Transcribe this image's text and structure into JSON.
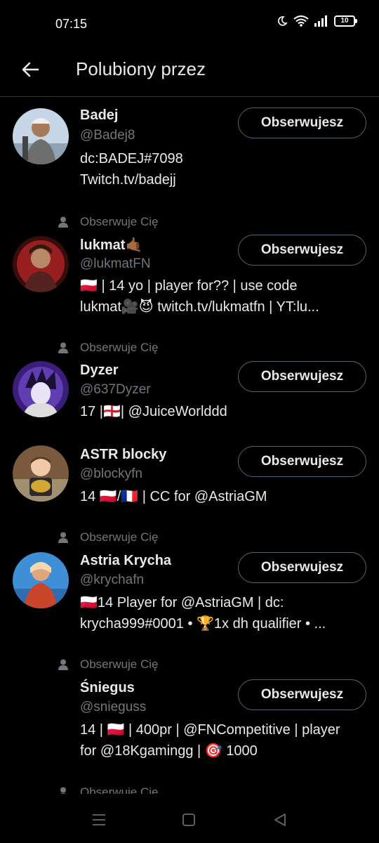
{
  "status_bar": {
    "time": "07:15",
    "battery_level": "10",
    "icons": [
      "moon-icon",
      "wifi-icon",
      "signal-icon",
      "battery-icon"
    ]
  },
  "header": {
    "title": "Polubiony przez",
    "back_icon": "arrow-left-icon"
  },
  "follows_you_label": "Obserwuje Cię",
  "follow_button_label": "Obserwujesz",
  "users": [
    {
      "name": "Badej",
      "handle": "@Badej8",
      "bio": [
        "dc:BADEJ#7098",
        "Twitch.tv/badejj"
      ],
      "follows_you": false
    },
    {
      "name": "lukmat🤙🏾",
      "handle": "@lukmatFN",
      "bio": [
        "🇵🇱 | 14 yo | player for?? | use code",
        "lukmat🎥😈 twitch.tv/lukmatfn | YT:lu..."
      ],
      "follows_you": true
    },
    {
      "name": "Dyzer",
      "handle": "@637Dyzer",
      "bio": [
        "17 |🏴󠁧󠁢󠁥󠁮󠁧󠁿| @JuiceWorlddd"
      ],
      "follows_you": true
    },
    {
      "name": "ASTR blocky",
      "handle": "@blockyfn",
      "bio": [
        "14 🇵🇱/🇫🇷 | CC for  @AstriaGM"
      ],
      "follows_you": false
    },
    {
      "name": "Astria Krycha",
      "handle": "@krychafn",
      "bio": [
        "🇵🇱14 Player for @AstriaGM | dc:",
        "krycha999#0001 • 🏆1x dh qualifier • ..."
      ],
      "follows_you": true
    },
    {
      "name": "Śniegus",
      "handle": "@snieguss",
      "bio": [
        "14 | 🇵🇱 | 400pr | @FNCompetitive | player",
        "for @18Kgamingg | 🎯 1000"
      ],
      "follows_you": true
    }
  ],
  "next_follows_you_label": "Obserwuje Cię",
  "nav_bar": {
    "icons": [
      "menu-icon",
      "home-square-icon",
      "back-triangle-icon"
    ]
  }
}
